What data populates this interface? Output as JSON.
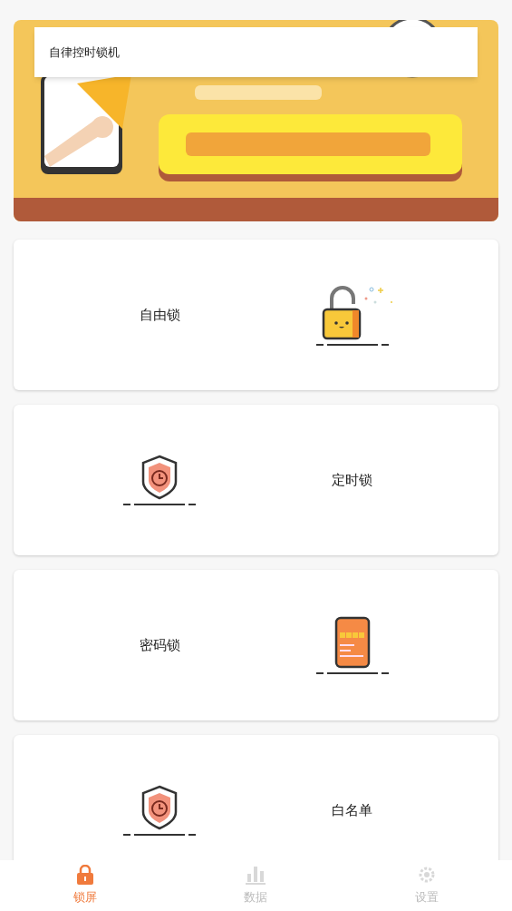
{
  "popup": {
    "title": "自律控时锁机"
  },
  "modes": [
    {
      "kind": "free",
      "label": "自由锁"
    },
    {
      "kind": "timed",
      "label": "定时锁"
    },
    {
      "kind": "password",
      "label": "密码锁"
    },
    {
      "kind": "whitelist",
      "label": "白名单"
    }
  ],
  "nav": [
    {
      "kind": "lock",
      "label": "锁屏",
      "selected": true
    },
    {
      "kind": "data",
      "label": "数据",
      "selected": false
    },
    {
      "kind": "settings",
      "label": "设置",
      "selected": false
    }
  ]
}
